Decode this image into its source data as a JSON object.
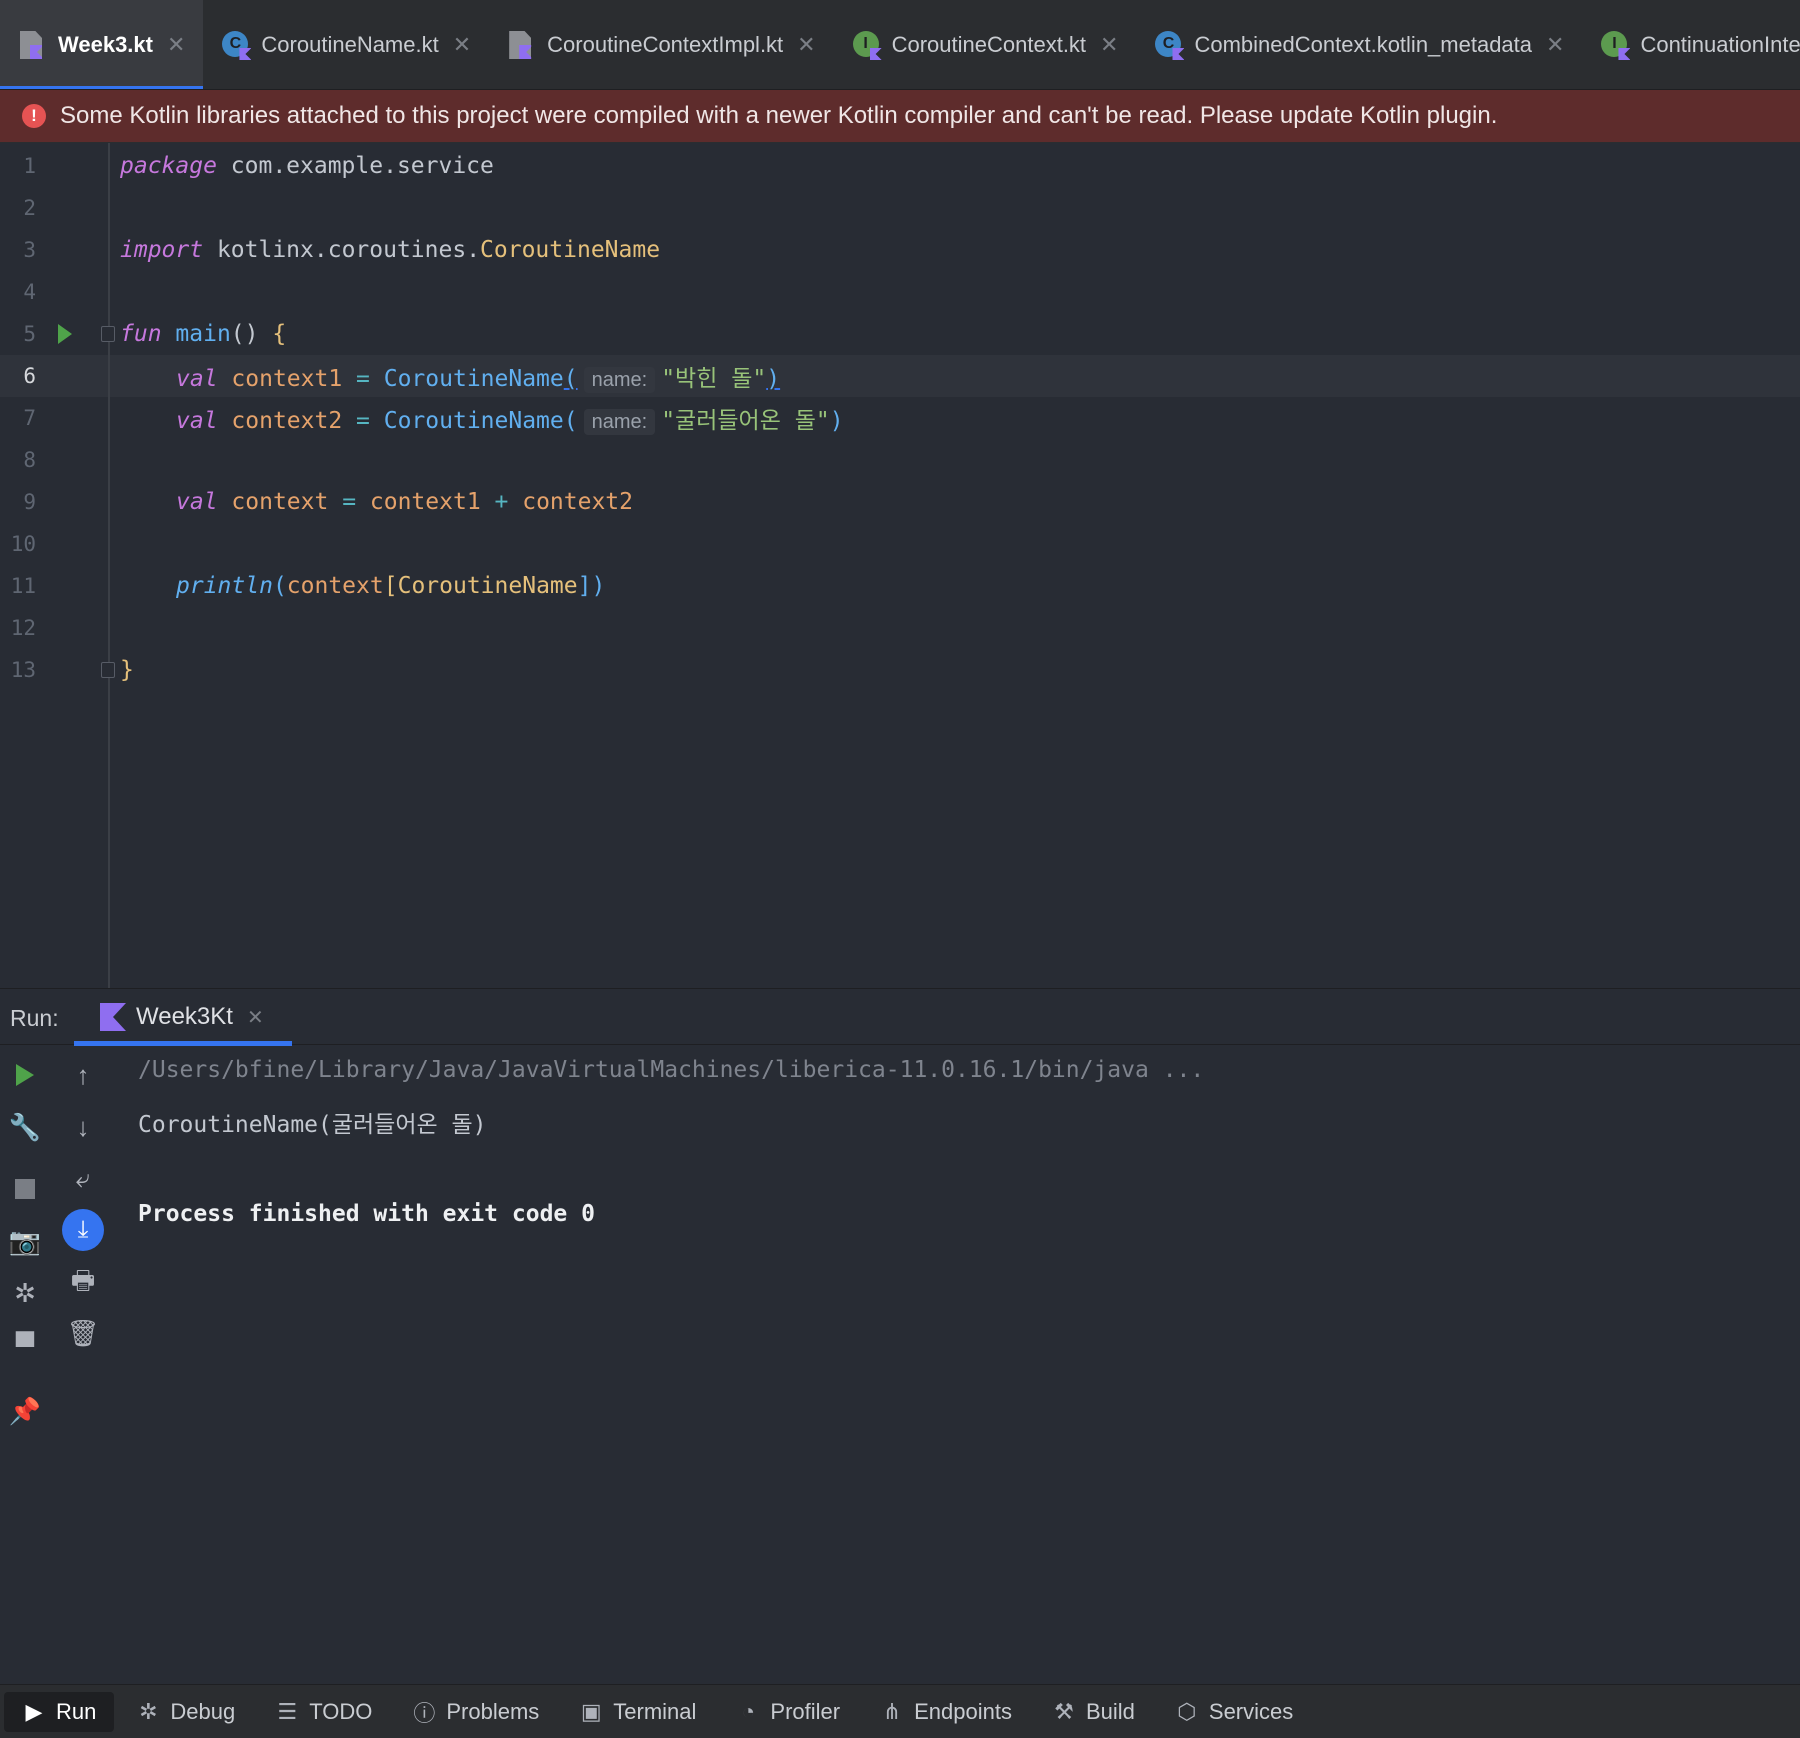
{
  "tabs": [
    {
      "label": "Week3.kt",
      "icon": "kotlin-file-icon",
      "active": true
    },
    {
      "label": "CoroutineName.kt",
      "icon": "kotlin-class-icon",
      "active": false
    },
    {
      "label": "CoroutineContextImpl.kt",
      "icon": "kotlin-file-icon",
      "active": false
    },
    {
      "label": "CoroutineContext.kt",
      "icon": "kotlin-interface-icon",
      "active": false
    },
    {
      "label": "CombinedContext.kotlin_metadata",
      "icon": "kotlin-class-icon",
      "active": false
    },
    {
      "label": "ContinuationInterceptor",
      "icon": "kotlin-interface-icon",
      "active": false
    }
  ],
  "banner": {
    "text": "Some Kotlin libraries attached to this project were compiled with a newer Kotlin compiler and can't be read. Please update Kotlin plugin."
  },
  "editor": {
    "current_line": 6,
    "line_numbers": [
      "1",
      "2",
      "3",
      "4",
      "5",
      "6",
      "7",
      "8",
      "9",
      "10",
      "11",
      "12",
      "13"
    ],
    "code": {
      "l1_kw": "package",
      "l1_rest": " com.example.service",
      "l3_kw": "import",
      "l3_pkg": " kotlinx.coroutines.",
      "l3_type": "CoroutineName",
      "l5_kw": "fun",
      "l5_fn": "main",
      "l5_rest": "() ",
      "l5_brace": "{",
      "l6_kw": "val",
      "l6_var": "context1",
      "l6_eq": " = ",
      "l6_ctor": "CoroutineName",
      "l6_open": "(",
      "l6_hint": "name:",
      "l6_str": "\"박힌 돌\"",
      "l6_close": ")",
      "l7_kw": "val",
      "l7_var": "context2",
      "l7_eq": " = ",
      "l7_ctor": "CoroutineName",
      "l7_open": "(",
      "l7_hint": "name:",
      "l7_str": "\"굴러들어온 돌\"",
      "l7_close": ")",
      "l9_kw": "val",
      "l9_var": "context",
      "l9_eq": " = ",
      "l9_a": "context1",
      "l9_plus": " + ",
      "l9_b": "context2",
      "l11_fn": "println",
      "l11_open": "(",
      "l11_ctx": "context",
      "l11_lb": "[",
      "l11_type": "CoroutineName",
      "l11_rb": "])",
      "l13_brace": "}"
    }
  },
  "run_panel": {
    "label": "Run:",
    "tab_label": "Week3Kt",
    "console": {
      "command": "/Users/bfine/Library/Java/JavaVirtualMachines/liberica-11.0.16.1/bin/java ...",
      "output": "CoroutineName(굴러들어온 돌)",
      "exit": "Process finished with exit code 0"
    }
  },
  "bottom_bar": [
    {
      "label": "Run",
      "icon": "play-icon",
      "active": true
    },
    {
      "label": "Debug",
      "icon": "bug-icon",
      "active": false
    },
    {
      "label": "TODO",
      "icon": "list-icon",
      "active": false
    },
    {
      "label": "Problems",
      "icon": "alert-icon",
      "active": false
    },
    {
      "label": "Terminal",
      "icon": "terminal-icon",
      "active": false
    },
    {
      "label": "Profiler",
      "icon": "profiler-icon",
      "active": false
    },
    {
      "label": "Endpoints",
      "icon": "endpoints-icon",
      "active": false
    },
    {
      "label": "Build",
      "icon": "hammer-icon",
      "active": false
    },
    {
      "label": "Services",
      "icon": "services-icon",
      "active": false
    }
  ],
  "colors": {
    "accent": "#3574f0",
    "error_banner": "#5e2c2c",
    "run_green": "#4fa34a",
    "keyword": "#c678dd",
    "string": "#98c379"
  }
}
